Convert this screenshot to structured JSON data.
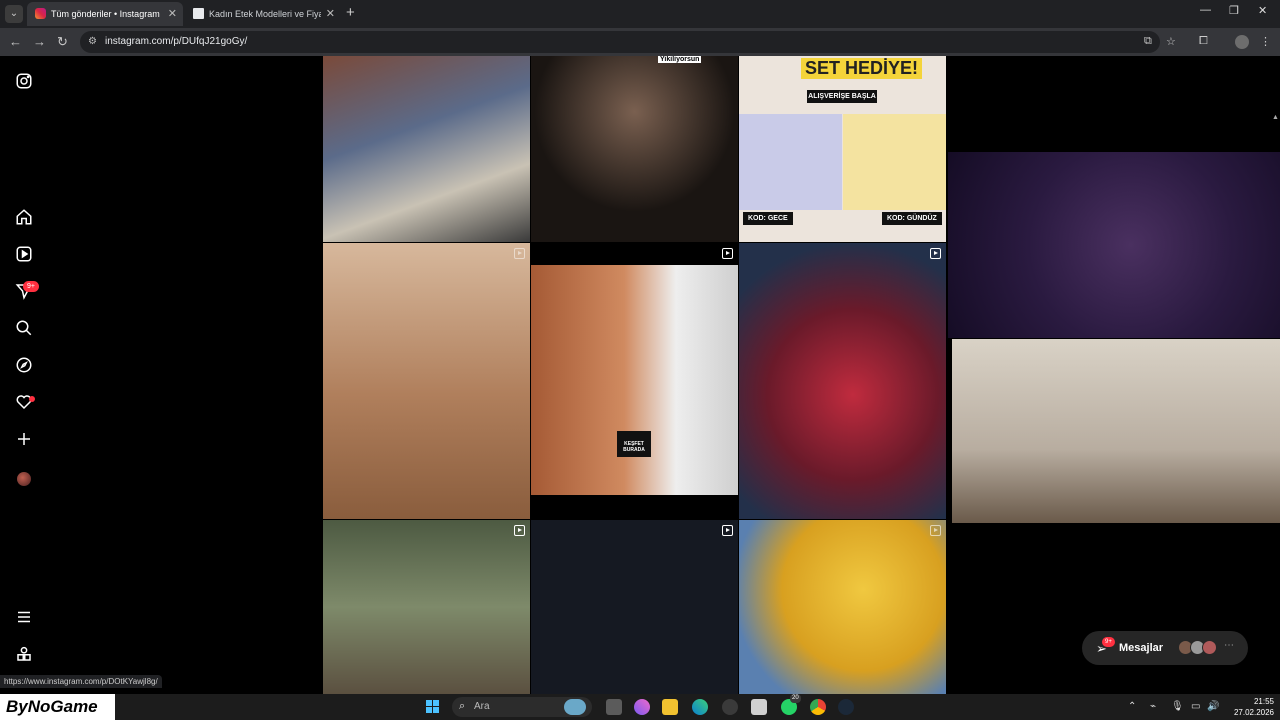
{
  "browser": {
    "tabs": [
      {
        "title": "Tüm gönderiler • Instagram",
        "active": true
      },
      {
        "title": "Kadın Etek Modelleri ve Fiyatları",
        "active": false
      }
    ],
    "url": "instagram.com/p/DUfqJ21goGy/",
    "hover_url": "https://www.instagram.com/p/DOtKYawjl8g/"
  },
  "instagram": {
    "notification_badge": "9+",
    "posts": [
      {
        "caption": "Yikiliyorsun"
      },
      {
        "headline": "SET HEDİYE!",
        "cta": "ALIŞVERİŞE BAŞLA",
        "code_left": "KOD: GECE",
        "code_right": "KOD: GÜNDÜZ"
      },
      {
        "overlay": "KEŞFET BURADA"
      }
    ],
    "messages": {
      "label": "Mesajlar",
      "badge": "9+"
    }
  },
  "taskbar": {
    "logo": "ByNoGame",
    "search_placeholder": "Ara",
    "whatsapp_badge": "20",
    "time": "21:55",
    "date": "27.02.2026"
  },
  "colors": {
    "accent": "#ff3040",
    "page_bg": "#000000",
    "chrome_bg": "#202124"
  }
}
